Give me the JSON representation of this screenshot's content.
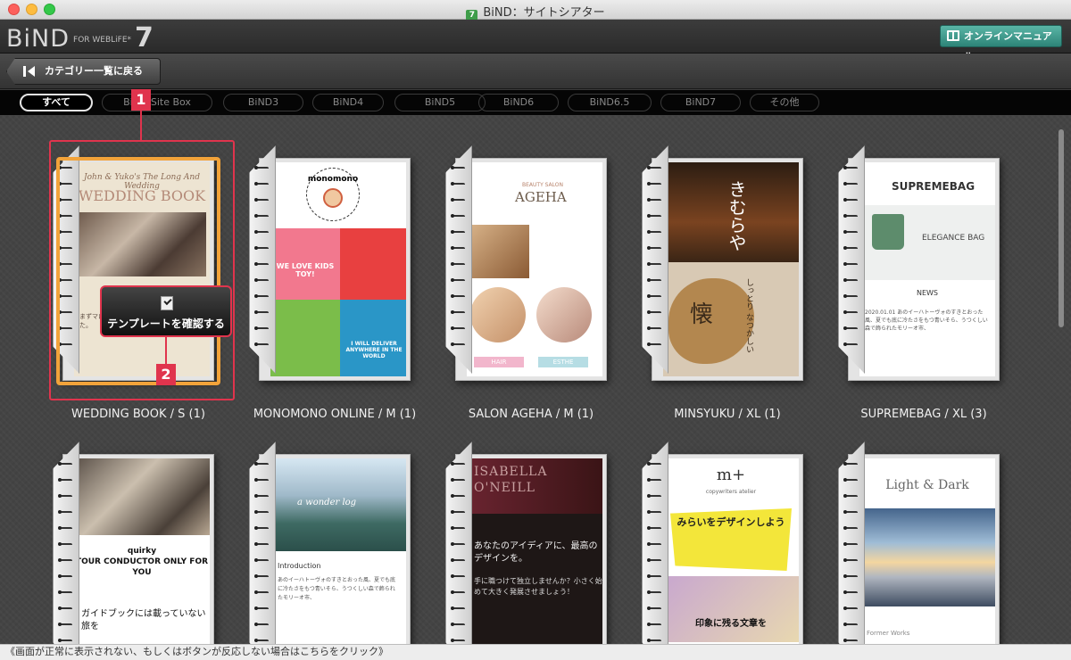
{
  "window": {
    "title": "BiND：サイトシアター",
    "icon_label": "7"
  },
  "header": {
    "logo": {
      "name": "BiND",
      "tagline": "FOR WEBLiFE*",
      "version": "7"
    },
    "manual_button": "オンラインマニュアル"
  },
  "toolbar": {
    "back_button": "カテゴリー一覧に戻る"
  },
  "filters": [
    "すべて",
    "BiND Site Box",
    "BiND3",
    "BiND4",
    "BiND5",
    "BiND6",
    "BiND6.5",
    "BiND7",
    "その他"
  ],
  "filters_active": "すべて",
  "templates": [
    {
      "label": "WEDDING BOOK / S (1)",
      "page_title": "WEDDING BOOK",
      "page_sub": "John & Yuko's The Long And Wedding",
      "page_text": "まずマロニエヴィロでまず一日過ごしました。"
    },
    {
      "label": "MONOMONO ONLINE / M (1)",
      "logo_text": "monomono",
      "tile1": "WE LOVE KIDS TOY!",
      "tile2": "I WILL DELIVER ANYWHERE IN THE WORLD"
    },
    {
      "label": "SALON AGEHA / M (1)",
      "brand_small": "BEAUTY SALON",
      "brand": "AGEHA",
      "tag1": "HAIR",
      "tag2": "ESTHE"
    },
    {
      "label": "MINSYUKU / XL (1)",
      "kanji_top": "きむらや",
      "kanji_main": "懐",
      "kanji_side": "しっとり なつかしい"
    },
    {
      "label": "SUPREMEBAG / XL (3)",
      "brand": "SUPREMEBAG",
      "hero": "ELEGANCE BAG",
      "news": "NEWS",
      "news_text": "2020.01.01 あのイーハトーヴォのすきとおった風、夏でも底に冷たさをもつ青いそら、うつくしい森で飾られたモリーオ市、"
    },
    {
      "label": "",
      "page_tag": "quirky",
      "page_head": "TOUR CONDUCTOR ONLY FOR YOU",
      "page_text": "ガイドブックには載っていない旅を"
    },
    {
      "label": "",
      "page_head": "a wonder log",
      "intro": "Introduction",
      "page_text": "あのイーハトーヴォのすきとおった風、夏でも底に冷たさをもつ青いそら、うつくしい森で飾られたモリーオ市、"
    },
    {
      "label": "",
      "name": "ISABELLA O'NEILL",
      "page_head": "あなたのアイディアに、最高のデザインを。",
      "page_text": "手に職つけて独立しませんか？小さく始めて大きく発展させましょう！"
    },
    {
      "label": "",
      "logo": "m+",
      "sub": "copywriters atelier",
      "page_head": "みらいをデザインしよう",
      "page_foot": "印象に残る文章を"
    },
    {
      "label": "",
      "page_head": "Light & Dark",
      "page_foot": "Former Works"
    }
  ],
  "confirm_button": "テンプレートを確認する",
  "callouts": [
    "1",
    "2"
  ],
  "status_text": "《画面が正常に表示されない、もしくはボタンが反応しない場合はこちらをクリック》",
  "colors": {
    "accent_teal": "#2d8478",
    "selection_red": "#e0344d",
    "selection_orange": "#f2a33a"
  }
}
